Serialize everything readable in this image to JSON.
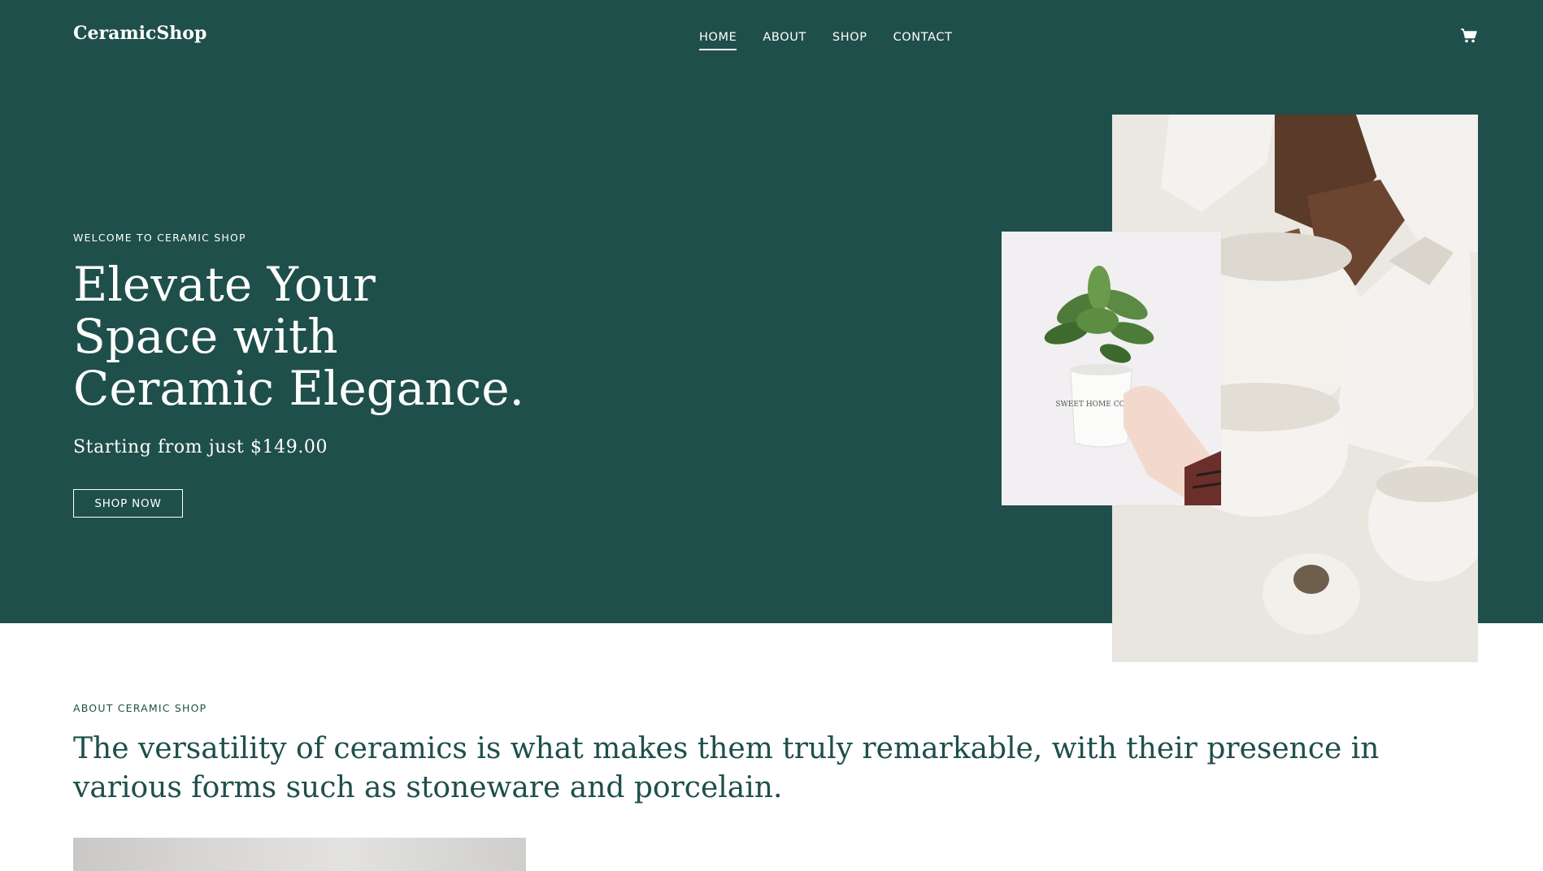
{
  "header": {
    "brand": "CeramicShop",
    "nav": [
      {
        "label": "HOME",
        "active": true
      },
      {
        "label": "ABOUT",
        "active": false
      },
      {
        "label": "SHOP",
        "active": false
      },
      {
        "label": "CONTACT",
        "active": false
      }
    ],
    "cart_icon": "shopping-cart-icon"
  },
  "hero": {
    "eyebrow": "WELCOME TO CERAMIC SHOP",
    "headline_line1": "Elevate Your",
    "headline_line2": "Space with",
    "headline_line3": "Ceramic Elegance.",
    "price_text": "Starting from just $149.00",
    "cta_label": "SHOP NOW",
    "small_image_label": "SWEET HOME COFFEE",
    "bg_color": "#1f4f4a"
  },
  "about": {
    "eyebrow": "ABOUT CERAMIC SHOP",
    "text": "The versatility of ceramics is what makes them truly remarkable, with their presence in various forms such as stoneware and porcelain."
  }
}
